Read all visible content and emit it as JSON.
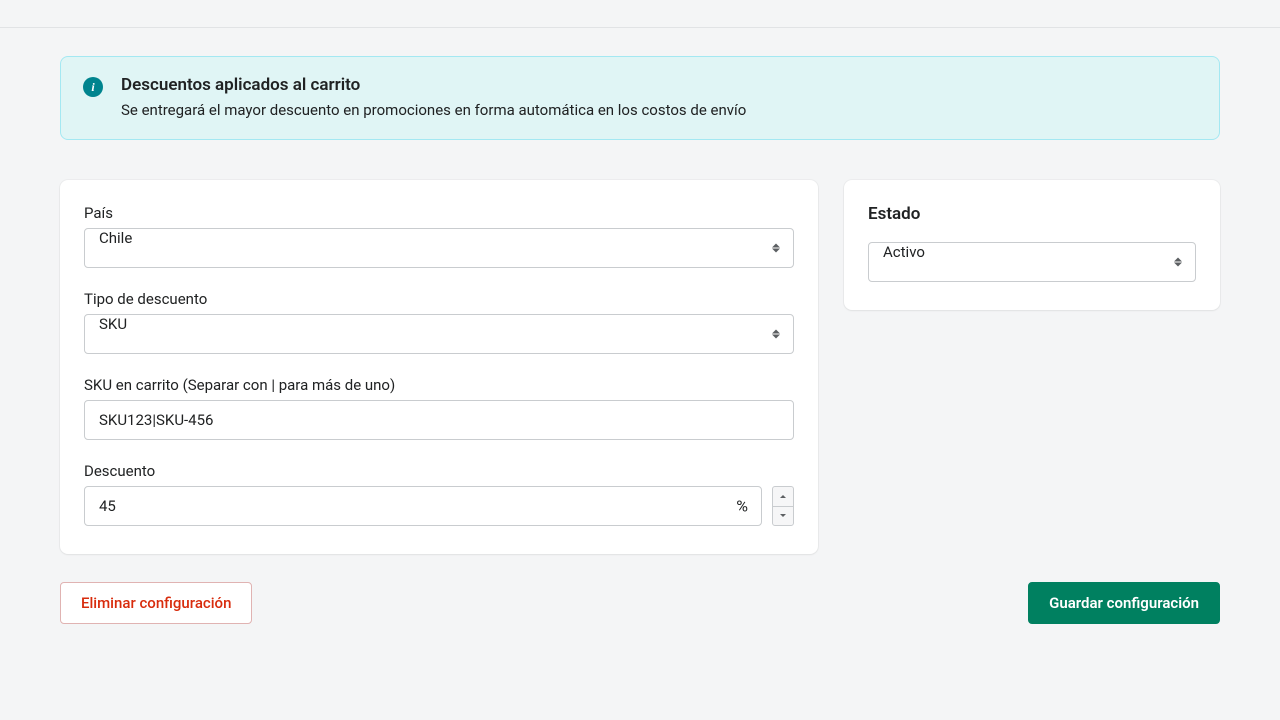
{
  "banner": {
    "title": "Descuentos aplicados al carrito",
    "description": "Se entregará el mayor descuento en promociones en forma automática en los costos de envío"
  },
  "form": {
    "country": {
      "label": "País",
      "value": "Chile"
    },
    "discountType": {
      "label": "Tipo de descuento",
      "value": "SKU"
    },
    "sku": {
      "label": "SKU en carrito (Separar con | para más de uno)",
      "value": "SKU123|SKU-456"
    },
    "discount": {
      "label": "Descuento",
      "value": "45",
      "unit": "%"
    }
  },
  "sidebar": {
    "title": "Estado",
    "status": {
      "value": "Activo"
    }
  },
  "actions": {
    "delete": "Eliminar configuración",
    "save": "Guardar configuración"
  }
}
